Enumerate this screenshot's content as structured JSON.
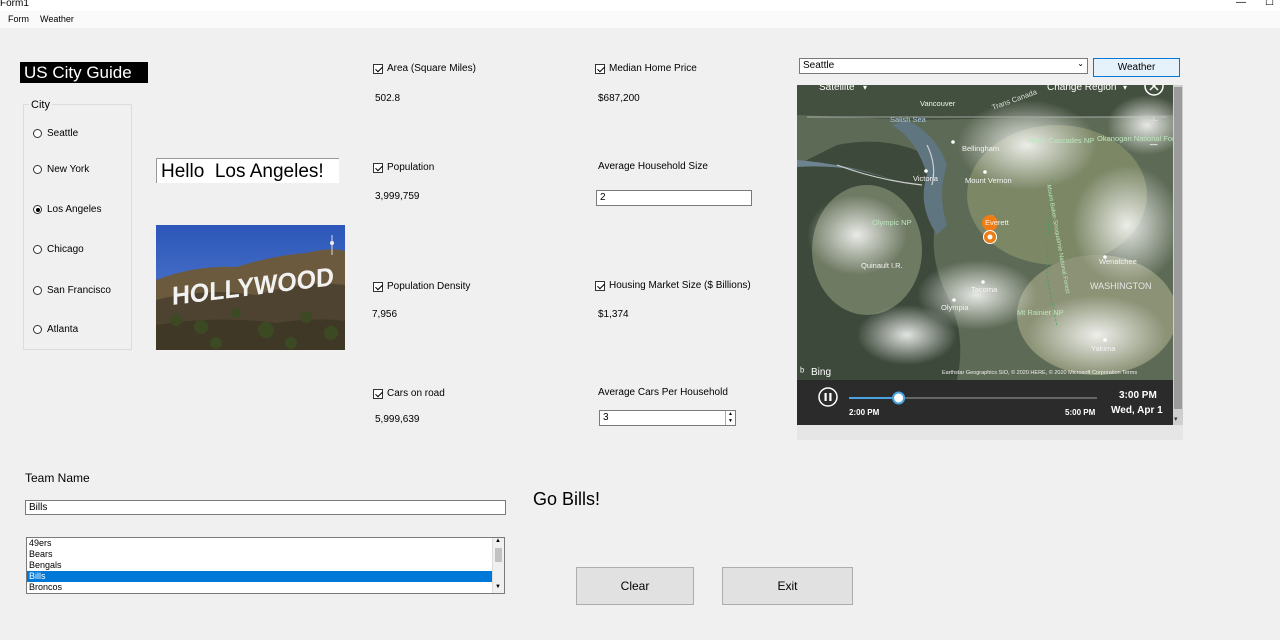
{
  "window": {
    "title": "Form1",
    "minimize": "—",
    "maximize": "☐"
  },
  "menu": [
    "Form",
    "Weather"
  ],
  "app_title": "US City Guide",
  "city_group": {
    "legend": "City",
    "options": [
      "Seattle",
      "New York",
      "Los Angeles",
      "Chicago",
      "San Francisco",
      "Atlanta"
    ],
    "selected": "Los Angeles"
  },
  "hello_text": "Hello  Los Angeles!",
  "image": {
    "sign_text": "HOLLYWOOD"
  },
  "stats": {
    "area": {
      "label": "Area (Square Miles)",
      "value": "502.8",
      "checked": true
    },
    "median_home_price": {
      "label": "Median Home Price",
      "value": "$687,200",
      "checked": true
    },
    "population": {
      "label": "Population",
      "value": "3,999,759",
      "checked": true
    },
    "household_size": {
      "label": "Average Household Size",
      "value": "2"
    },
    "population_density": {
      "label": "Population Density",
      "value": "7,956",
      "checked": true
    },
    "housing_market": {
      "label": "Housing Market Size ($ Billions)",
      "value": "$1,374",
      "checked": true
    },
    "cars_on_road": {
      "label": "Cars on road",
      "value": "5,999,639",
      "checked": true
    },
    "cars_per_household": {
      "label": "Average Cars Per Household",
      "value": "3"
    }
  },
  "weather": {
    "city_combo": "Seattle",
    "button_label": "Weather",
    "map": {
      "mode": "Satellite",
      "change_region": "Change Region",
      "labels": [
        "Vancouver",
        "Salish Sea",
        "Bellingham",
        "Victoria",
        "Mount Vernon",
        "Everett",
        "Olympic NP",
        "Quinault I.R.",
        "Tacoma",
        "Olympia",
        "Mt Rainier NP",
        "Wenatchee",
        "WASHINGTON",
        "Yakima",
        "North Cascades NP",
        "Okanogan National Forest",
        "Trans Canada",
        "Mount Baker-Snoqualmie National Forest"
      ],
      "attribution": "Earthstar Geographics SIO, © 2020 HERE, © 2020 Microsoft Corporation  Terms",
      "brand": "Bing"
    },
    "timeline": {
      "start": "2:00 PM",
      "end": "5:00 PM",
      "current_time": "3:00 PM",
      "current_date": "Wed, Apr 1",
      "progress": 0.2
    }
  },
  "team": {
    "label": "Team Name",
    "value": "Bills",
    "list": [
      "49ers",
      "Bears",
      "Bengals",
      "Bills",
      "Broncos"
    ],
    "selected": "Bills",
    "go_text": "Go Bills!"
  },
  "buttons": {
    "clear": "Clear",
    "exit": "Exit"
  }
}
